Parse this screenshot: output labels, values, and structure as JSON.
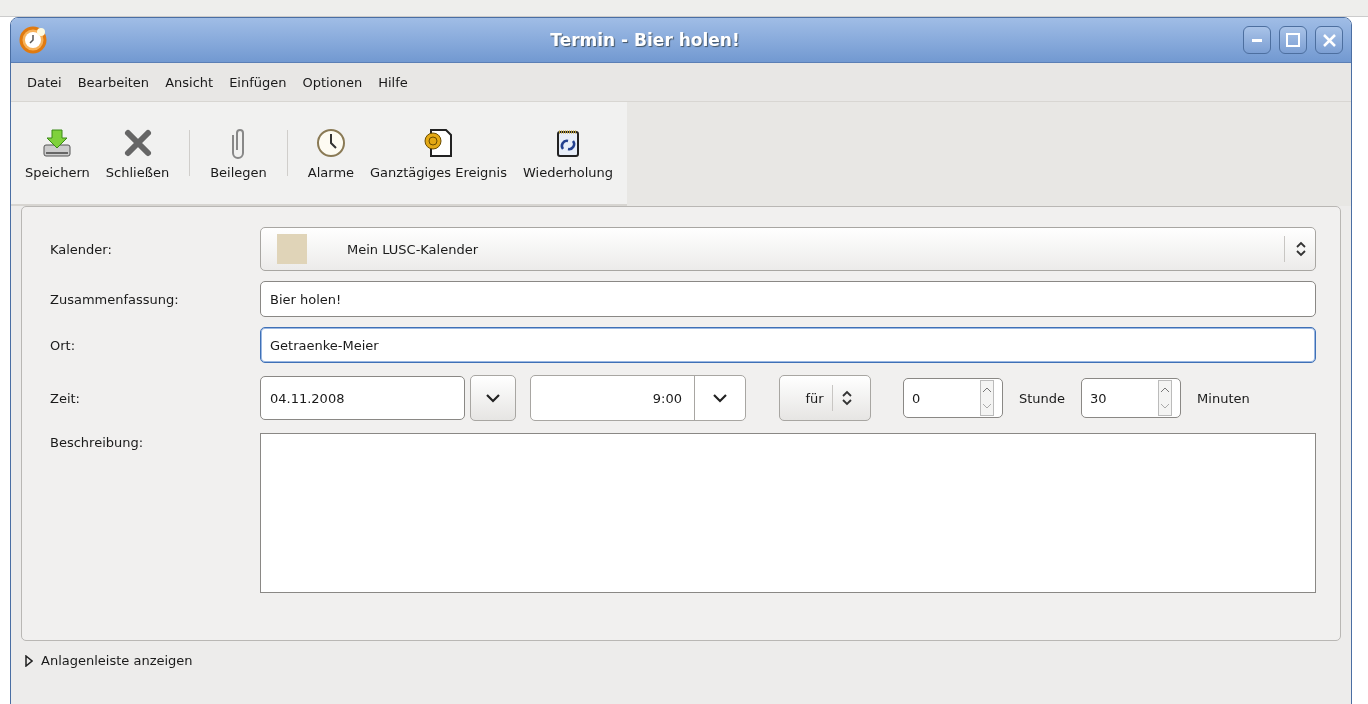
{
  "window": {
    "title": "Termin - Bier holen!"
  },
  "menu": [
    {
      "label": "Datei"
    },
    {
      "label": "Bearbeiten"
    },
    {
      "label": "Ansicht"
    },
    {
      "label": "Einfügen"
    },
    {
      "label": "Optionen"
    },
    {
      "label": "Hilfe"
    }
  ],
  "toolbar": [
    {
      "kind": "save",
      "label": "Speichern"
    },
    {
      "kind": "close",
      "label": "Schließen"
    },
    {
      "kind": "separator"
    },
    {
      "kind": "attach",
      "label": "Beilegen"
    },
    {
      "kind": "separator"
    },
    {
      "kind": "alarm",
      "label": "Alarme"
    },
    {
      "kind": "allday",
      "label": "Ganztägiges Ereignis"
    },
    {
      "kind": "recurrence",
      "label": "Wiederholung"
    }
  ],
  "calendar": {
    "label": "Kalender:",
    "value": "Mein LUSC-Kalender",
    "color": "#e0d4b8"
  },
  "summary": {
    "label": "Zusammenfassung:",
    "value": "Bier holen!",
    "focused": false
  },
  "location": {
    "label": "Ort:",
    "value": "Getraenke-Meier",
    "focused": true
  },
  "time": {
    "label": "Zeit:",
    "date": "04.11.2008",
    "time": "9:00",
    "mode": "für",
    "hours": "0",
    "hours_unit": "Stunde",
    "minutes": "30",
    "minutes_unit": "Minuten"
  },
  "description": {
    "label": "Beschreibung:"
  },
  "expander": {
    "label": "Anlagenleiste anzeigen",
    "expanded": false
  }
}
